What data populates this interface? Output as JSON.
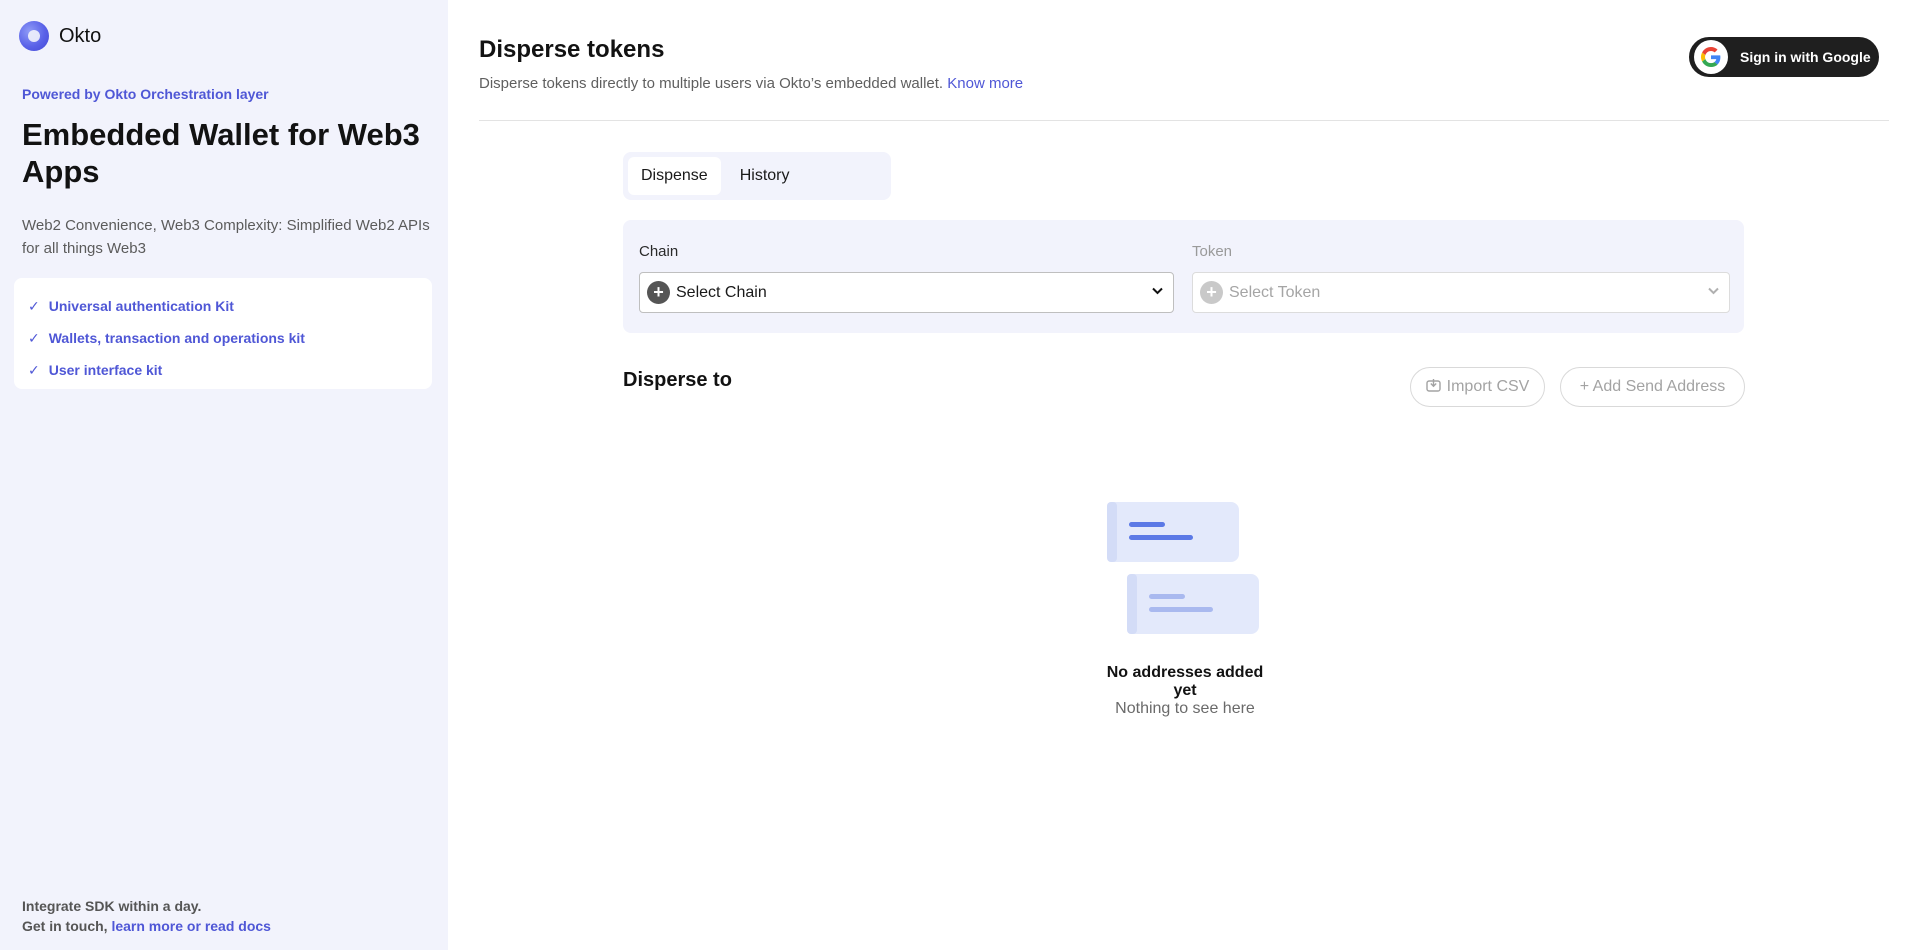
{
  "sidebar": {
    "brand_name": "Okto",
    "powered_by": "Powered by Okto Orchestration layer",
    "title": "Embedded Wallet for Web3 Apps",
    "description": "Web2 Convenience, Web3 Complexity: Simplified Web2 APIs for all things Web3",
    "features": [
      "Universal authentication Kit",
      "Wallets, transaction and operations kit",
      "User interface kit"
    ],
    "footer_line1": "Integrate SDK within a day.",
    "footer_line2_prefix": "Get in touch,",
    "footer_link": "learn more or read docs"
  },
  "header": {
    "title": "Disperse tokens",
    "subtitle": "Disperse tokens directly to multiple users via Okto’s embedded wallet.",
    "know_more": "Know more",
    "google_button": "Sign in with Google"
  },
  "tabs": [
    {
      "label": "Dispense",
      "active": true
    },
    {
      "label": "History",
      "active": false
    }
  ],
  "form": {
    "chain_label": "Chain",
    "chain_value": "Select Chain",
    "token_label": "Token",
    "token_value": "Select Token"
  },
  "disperse": {
    "title": "Disperse to",
    "import_csv": "Import CSV",
    "add_address": "+ Add Send Address",
    "empty_title": "No addresses added yet",
    "empty_subtitle": "Nothing to see here"
  },
  "colors": {
    "accent": "#4f57d6",
    "sidebar_bg": "#f2f3fc",
    "dark_button": "#1f1f1f"
  }
}
